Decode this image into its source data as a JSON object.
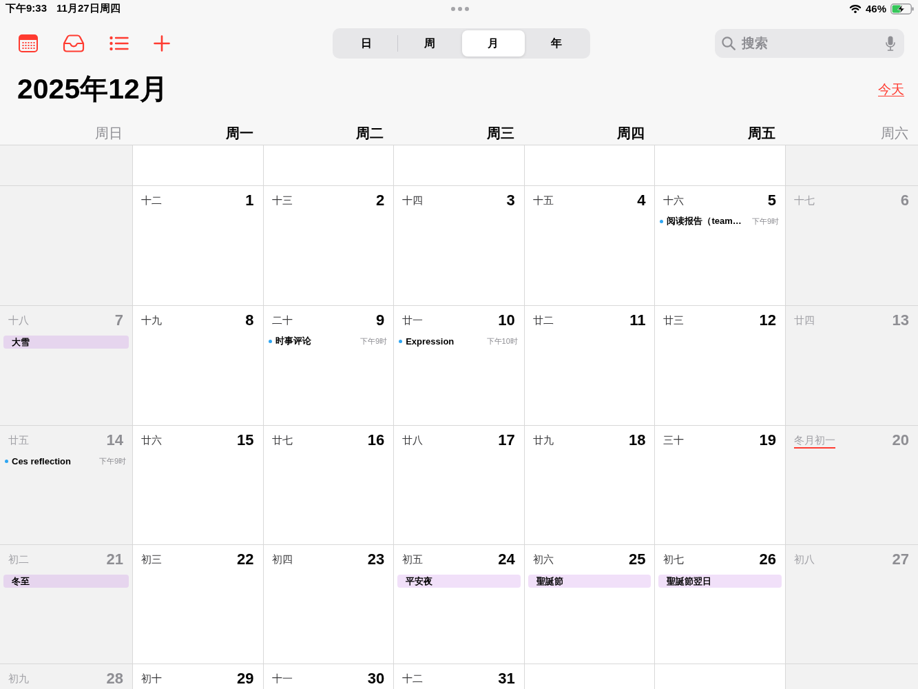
{
  "status_bar": {
    "time": "下午9:33",
    "date": "11月27日周四",
    "battery": "46%",
    "charging": true
  },
  "toolbar": {
    "view_tabs": [
      {
        "label": "日",
        "selected": false
      },
      {
        "label": "周",
        "selected": false
      },
      {
        "label": "月",
        "selected": true
      },
      {
        "label": "年",
        "selected": false
      }
    ],
    "search": {
      "placeholder": "搜索"
    }
  },
  "header": {
    "title": "2025年12月",
    "today_link": "今天"
  },
  "weekdays": [
    {
      "label": "周日",
      "weekend": true
    },
    {
      "label": "周一",
      "weekend": false
    },
    {
      "label": "周二",
      "weekend": false
    },
    {
      "label": "周三",
      "weekend": false
    },
    {
      "label": "周四",
      "weekend": false
    },
    {
      "label": "周五",
      "weekend": false
    },
    {
      "label": "周六",
      "weekend": true
    }
  ],
  "weeks": [
    {
      "days": [
        {
          "kind": "blank"
        },
        {
          "kind": "blank"
        },
        {
          "kind": "blank"
        },
        {
          "kind": "blank"
        },
        {
          "kind": "blank"
        },
        {
          "kind": "blank"
        },
        {
          "kind": "blank"
        }
      ]
    },
    {
      "days": [
        {
          "kind": "blank"
        },
        {
          "kind": "day",
          "lunar": "十二",
          "number": "1",
          "lunar_underlined": false
        },
        {
          "kind": "day",
          "lunar": "十三",
          "number": "2",
          "lunar_underlined": false
        },
        {
          "kind": "day",
          "lunar": "十四",
          "number": "3",
          "lunar_underlined": false
        },
        {
          "kind": "day",
          "lunar": "十五",
          "number": "4",
          "lunar_underlined": false
        },
        {
          "kind": "day",
          "lunar": "十六",
          "number": "5",
          "lunar_underlined": false,
          "events": [
            {
              "kind": "timed",
              "title": "阅读报告（team…",
              "time": "下午9时"
            }
          ]
        },
        {
          "kind": "day",
          "lunar": "十七",
          "number": "6",
          "lunar_underlined": false
        }
      ]
    },
    {
      "days": [
        {
          "kind": "day",
          "lunar": "十八",
          "number": "7",
          "lunar_underlined": false,
          "events": [
            {
              "kind": "all_day",
              "title": "大雪"
            }
          ]
        },
        {
          "kind": "day",
          "lunar": "十九",
          "number": "8",
          "lunar_underlined": false
        },
        {
          "kind": "day",
          "lunar": "二十",
          "number": "9",
          "lunar_underlined": false,
          "events": [
            {
              "kind": "timed",
              "title": "时事评论",
              "time": "下午9时"
            }
          ]
        },
        {
          "kind": "day",
          "lunar": "廿一",
          "number": "10",
          "lunar_underlined": false,
          "events": [
            {
              "kind": "timed",
              "title": "Expression",
              "time": "下午10时"
            }
          ]
        },
        {
          "kind": "day",
          "lunar": "廿二",
          "number": "11",
          "lunar_underlined": false
        },
        {
          "kind": "day",
          "lunar": "廿三",
          "number": "12",
          "lunar_underlined": false
        },
        {
          "kind": "day",
          "lunar": "廿四",
          "number": "13",
          "lunar_underlined": false
        }
      ]
    },
    {
      "days": [
        {
          "kind": "day",
          "lunar": "廿五",
          "number": "14",
          "lunar_underlined": false,
          "events": [
            {
              "kind": "timed",
              "title": "Ces reflection",
              "time": "下午9时"
            }
          ]
        },
        {
          "kind": "day",
          "lunar": "廿六",
          "number": "15",
          "lunar_underlined": false
        },
        {
          "kind": "day",
          "lunar": "廿七",
          "number": "16",
          "lunar_underlined": false
        },
        {
          "kind": "day",
          "lunar": "廿八",
          "number": "17",
          "lunar_underlined": false
        },
        {
          "kind": "day",
          "lunar": "廿九",
          "number": "18",
          "lunar_underlined": false
        },
        {
          "kind": "day",
          "lunar": "三十",
          "number": "19",
          "lunar_underlined": false
        },
        {
          "kind": "day",
          "lunar": "冬月初一",
          "number": "20",
          "lunar_underlined": true
        }
      ]
    },
    {
      "days": [
        {
          "kind": "day",
          "lunar": "初二",
          "number": "21",
          "lunar_underlined": false,
          "events": [
            {
              "kind": "all_day",
              "title": "冬至"
            }
          ]
        },
        {
          "kind": "day",
          "lunar": "初三",
          "number": "22",
          "lunar_underlined": false
        },
        {
          "kind": "day",
          "lunar": "初四",
          "number": "23",
          "lunar_underlined": false
        },
        {
          "kind": "day",
          "lunar": "初五",
          "number": "24",
          "lunar_underlined": false,
          "events": [
            {
              "kind": "all_day",
              "title": "平安夜"
            }
          ]
        },
        {
          "kind": "day",
          "lunar": "初六",
          "number": "25",
          "lunar_underlined": false,
          "events": [
            {
              "kind": "all_day",
              "title": "聖誕節"
            }
          ]
        },
        {
          "kind": "day",
          "lunar": "初七",
          "number": "26",
          "lunar_underlined": false,
          "events": [
            {
              "kind": "all_day",
              "title": "聖誕節翌日"
            }
          ]
        },
        {
          "kind": "day",
          "lunar": "初八",
          "number": "27",
          "lunar_underlined": false
        }
      ]
    },
    {
      "days": [
        {
          "kind": "day",
          "lunar": "初九",
          "number": "28",
          "lunar_underlined": false
        },
        {
          "kind": "day",
          "lunar": "初十",
          "number": "29",
          "lunar_underlined": false
        },
        {
          "kind": "day",
          "lunar": "十一",
          "number": "30",
          "lunar_underlined": false
        },
        {
          "kind": "day",
          "lunar": "十二",
          "number": "31",
          "lunar_underlined": false
        },
        {
          "kind": "blank"
        },
        {
          "kind": "blank"
        },
        {
          "kind": "blank"
        }
      ]
    }
  ]
}
